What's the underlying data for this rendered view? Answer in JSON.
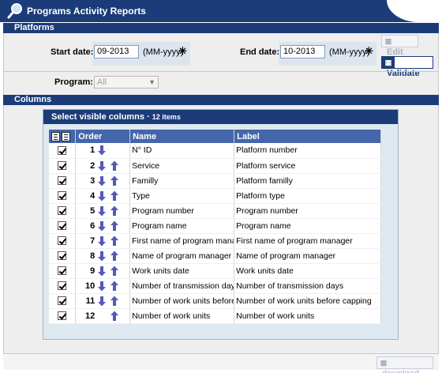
{
  "header": {
    "title": "Programs Activity Reports",
    "logo_icon": "magnifier-icon"
  },
  "platforms": {
    "section_label": "Platforms",
    "start_date": {
      "label": "Start date:",
      "value": "09-2013",
      "format": "(MM-yyyy)",
      "required_mark": "✳"
    },
    "end_date": {
      "label": "End date:",
      "value": "10-2013",
      "format": "(MM-yyyy)",
      "required_mark": "✳"
    },
    "edit_button": {
      "label": "Edit",
      "icon": "grid-icon",
      "enabled": false
    },
    "validate_button": {
      "label": "Validate",
      "icon": "grid-icon",
      "enabled": true
    },
    "program": {
      "label": "Program:",
      "selected": "All",
      "enabled": false
    }
  },
  "columns": {
    "section_label": "Columns",
    "panel_title": "Select visible columns",
    "count_label": "12 items",
    "headers": {
      "order": "Order",
      "name": "Name",
      "label": "Label"
    },
    "rows": [
      {
        "checked": true,
        "order": "1",
        "name": "N° ID",
        "label": "Platform number"
      },
      {
        "checked": true,
        "order": "2",
        "name": "Service",
        "label": "Platform service"
      },
      {
        "checked": true,
        "order": "3",
        "name": "Familly",
        "label": "Platform familly"
      },
      {
        "checked": true,
        "order": "4",
        "name": "Type",
        "label": "Platform type"
      },
      {
        "checked": true,
        "order": "5",
        "name": "Program number",
        "label": "Program number"
      },
      {
        "checked": true,
        "order": "6",
        "name": "Program name",
        "label": "Program name"
      },
      {
        "checked": true,
        "order": "7",
        "name": "First name of program manag",
        "label": "First name of program manager"
      },
      {
        "checked": true,
        "order": "8",
        "name": "Name of program manager",
        "label": "Name of program manager"
      },
      {
        "checked": true,
        "order": "9",
        "name": "Work units date",
        "label": "Work units date"
      },
      {
        "checked": true,
        "order": "10",
        "name": "Number of transmission days",
        "label": "Number of transmission days"
      },
      {
        "checked": true,
        "order": "11",
        "name": "Number of work units before c",
        "label": "Number of work units before capping"
      },
      {
        "checked": true,
        "order": "12",
        "name": "Number of work units",
        "label": "Number of work units"
      }
    ]
  },
  "footer": {
    "download_button": {
      "label": "download",
      "icon": "grid-icon",
      "enabled": false
    }
  },
  "colors": {
    "navy": "#1b3c78",
    "table_header": "#4466aa",
    "arrow": "#5558b8",
    "panel_bg": "#eeeeee",
    "date_bg": "#dce5ee"
  }
}
